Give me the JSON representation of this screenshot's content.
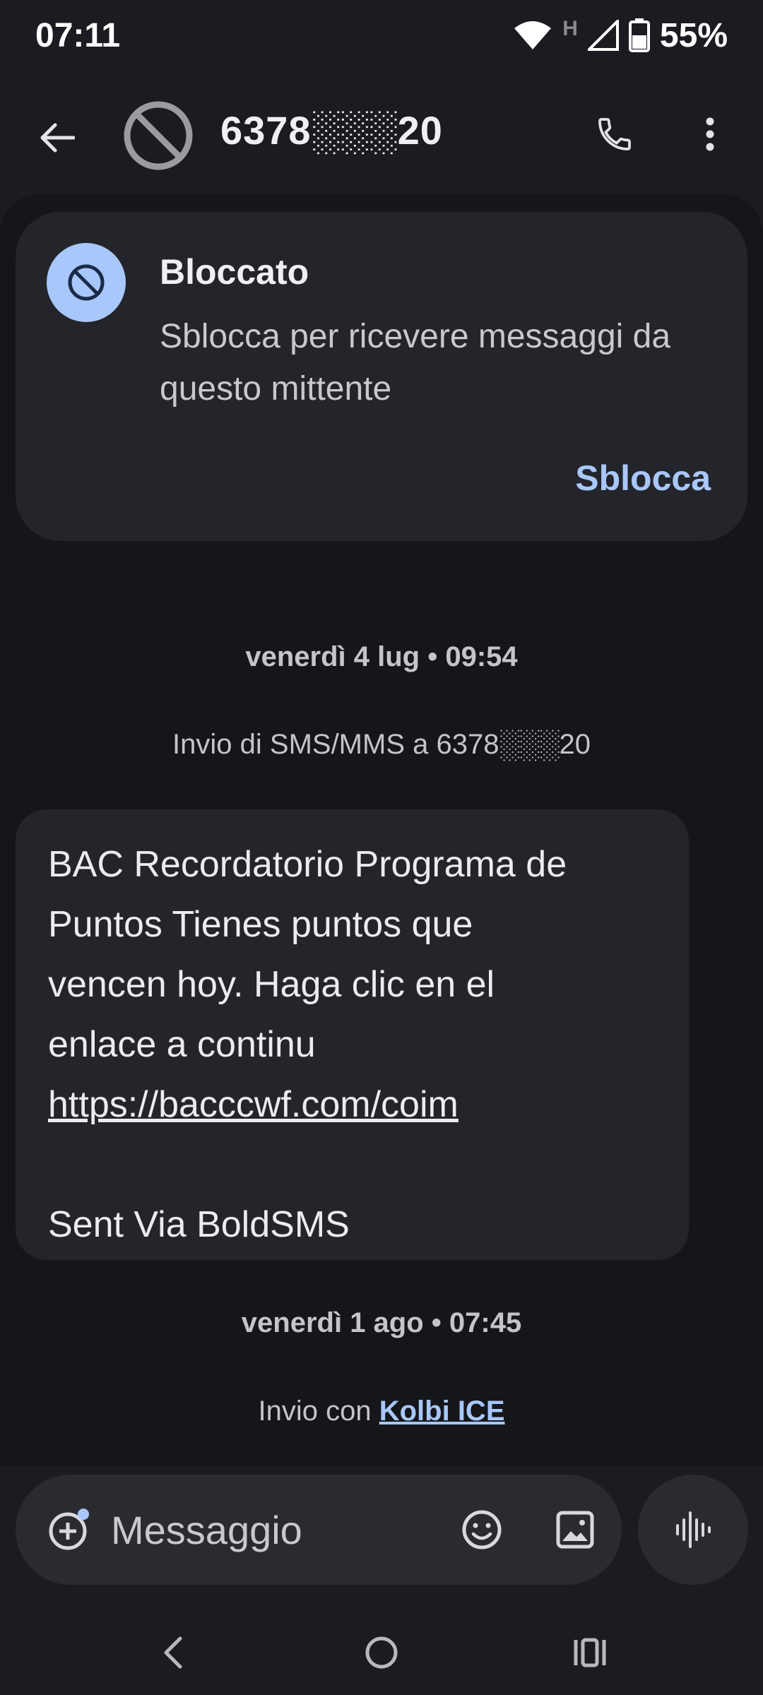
{
  "status_bar": {
    "time": "07:11",
    "network_label": "H",
    "battery": "55%"
  },
  "app_bar": {
    "contact_name": "6378░░░20",
    "icons": [
      "back-arrow-icon",
      "blocked-avatar-icon",
      "phone-icon",
      "more-vert-icon"
    ]
  },
  "blocked_card": {
    "title": "Bloccato",
    "description": "Sblocca per ricevere messaggi da questo mittente",
    "action_label": "Sblocca"
  },
  "conversation": {
    "date_1": "venerdì 4 lug • 09:54",
    "sending_info": "Invio di SMS/MMS a 6378░░░20",
    "message": {
      "text_line_1": "BAC Recordatorio Programa de",
      "text_line_2": "Puntos Tienes puntos que",
      "text_line_3": "vencen hoy. Haga clic en el",
      "text_line_4": "enlace a continu",
      "link": "https://bacccwf.com/coim",
      "footer": "Sent Via BoldSMS"
    },
    "date_2": "venerdì 1 ago • 07:45",
    "carrier_prefix": "Invio con",
    "carrier_name": "Kolbi ICE"
  },
  "composer": {
    "placeholder": "Messaggio",
    "value": ""
  },
  "colors": {
    "background": "#1b1c21",
    "panel": "#15161a",
    "card": "#24252b",
    "accent": "#a8c7fa"
  }
}
